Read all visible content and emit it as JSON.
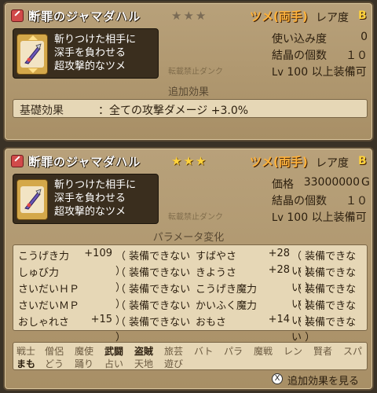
{
  "panel_top": {
    "name": "断罪のジャマダハル",
    "stars": "★★★",
    "category": "ツメ(両手)",
    "rarity_label": "レア度",
    "rarity": "B",
    "desc": [
      "斬りつけた相手に",
      "深手を負わせる",
      "超攻撃的なツメ"
    ],
    "stats": [
      {
        "label": "使い込み度",
        "value": "0"
      },
      {
        "label": "結晶の個数",
        "value": "１０"
      }
    ],
    "level": {
      "prefix": "Lv",
      "value": "100",
      "suffix": "以上装備可"
    },
    "watermark": "転載禁止ダンク",
    "section_title": "追加効果",
    "effect_label": "基礎効果",
    "effect_text": "：全ての攻撃ダメージ +3.0%"
  },
  "panel_bottom": {
    "name": "断罪のジャマダハル",
    "stars": "★★★",
    "category": "ツメ(両手)",
    "rarity_label": "レア度",
    "rarity": "B",
    "desc": [
      "斬りつけた相手に",
      "深手を負わせる",
      "超攻撃的なツメ"
    ],
    "price_label": "価格",
    "price": "33000000",
    "price_unit": "G",
    "crystal_label": "結晶の個数",
    "crystal_value": "１０",
    "level": {
      "prefix": "Lv",
      "value": "100",
      "suffix": "以上装備可"
    },
    "watermark": "転載禁止ダンク",
    "section_title": "パラメータ変化",
    "params_left": [
      {
        "name": "こうげき力",
        "bonus": "+109",
        "status": "（ 装備できない ）"
      },
      {
        "name": "しゅび力",
        "bonus": "",
        "status": "（ 装備できない ）"
      },
      {
        "name": "さいだいＨＰ",
        "bonus": "",
        "status": "（ 装備できない ）"
      },
      {
        "name": "さいだいＭＰ",
        "bonus": "",
        "status": "（ 装備できない ）"
      },
      {
        "name": "おしゃれさ",
        "bonus": "+15",
        "status": "（ 装備できない ）"
      }
    ],
    "params_right": [
      {
        "name": "すばやさ",
        "bonus": "+28",
        "status": "（ 装備できない ）"
      },
      {
        "name": "きようさ",
        "bonus": "+28",
        "status": "（ 装備できない ）"
      },
      {
        "name": "こうげき魔力",
        "bonus": "",
        "status": "（ 装備できない ）"
      },
      {
        "name": "かいふく魔力",
        "bonus": "",
        "status": "（ 装備できない ）"
      },
      {
        "name": "おもさ",
        "bonus": "+14",
        "status": "（ 装備できない ）"
      }
    ],
    "jobs_row1": [
      {
        "name": "戦士",
        "on": false
      },
      {
        "name": "僧侶",
        "on": false
      },
      {
        "name": "魔使",
        "on": false
      },
      {
        "name": "武闘",
        "on": true
      },
      {
        "name": "盗賊",
        "on": true
      },
      {
        "name": "旅芸",
        "on": false
      },
      {
        "name": "バト",
        "on": false
      },
      {
        "name": "パラ",
        "on": false
      },
      {
        "name": "魔戦",
        "on": false
      },
      {
        "name": "レン",
        "on": false
      },
      {
        "name": "賢者",
        "on": false
      },
      {
        "name": "スパ",
        "on": false
      }
    ],
    "jobs_row2": [
      {
        "name": "まも",
        "on": true
      },
      {
        "name": "どう",
        "on": false
      },
      {
        "name": "踊り",
        "on": false
      },
      {
        "name": "占い",
        "on": false
      },
      {
        "name": "天地",
        "on": false
      },
      {
        "name": "遊び",
        "on": false
      }
    ],
    "footer_button": "X",
    "footer_text": "追加効果を見る"
  }
}
